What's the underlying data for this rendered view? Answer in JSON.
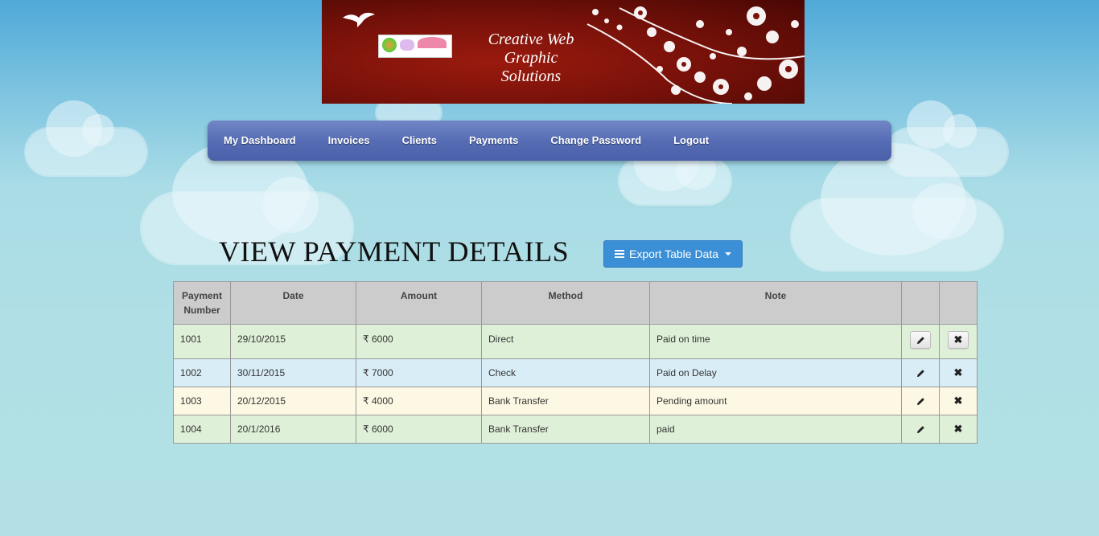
{
  "banner": {
    "title_lines": [
      "Creative Web",
      "Graphic",
      "Solutions"
    ]
  },
  "nav": {
    "items": [
      "My Dashboard",
      "Invoices",
      "Clients",
      "Payments",
      "Change Password",
      "Logout"
    ]
  },
  "page": {
    "title": "VIEW PAYMENT DETAILS",
    "export_label": "Export Table Data"
  },
  "table": {
    "headers": [
      "Payment Number",
      "Date",
      "Amount",
      "Method",
      "Note",
      "",
      ""
    ],
    "rows": [
      {
        "number": "1001",
        "date": "29/10/2015",
        "amount": "₹ 6000",
        "method": "Direct",
        "note": "Paid on time"
      },
      {
        "number": "1002",
        "date": "30/11/2015",
        "amount": "₹ 7000",
        "method": "Check",
        "note": "Paid on Delay"
      },
      {
        "number": "1003",
        "date": "20/12/2015",
        "amount": "₹ 4000",
        "method": "Bank Transfer",
        "note": "Pending amount"
      },
      {
        "number": "1004",
        "date": "20/1/2016",
        "amount": "₹ 6000",
        "method": "Bank Transfer",
        "note": "paid"
      }
    ]
  },
  "icons": {
    "edit": "pencil-icon",
    "delete": "close-icon",
    "menu": "list-icon",
    "caret": "caret-down-icon"
  },
  "colors": {
    "navbar": "#566db5",
    "export_button": "#3a8fd6",
    "row_success": "#dff0d8",
    "row_info": "#d9edf7",
    "row_warning": "#fcf8e3",
    "banner": "#7a120a"
  }
}
